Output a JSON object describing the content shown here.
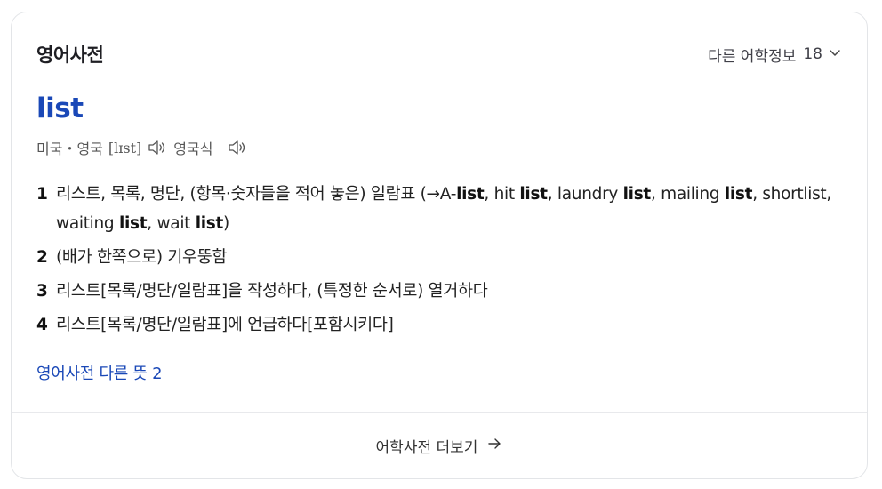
{
  "header": {
    "title": "영어사전",
    "more_label": "다른 어학정보",
    "more_count": "18"
  },
  "entry": {
    "word": "list",
    "pron_region_1": "미국・영국",
    "ipa": "[lɪst]",
    "pron_region_2": "영국식"
  },
  "definitions": [
    {
      "num": "1",
      "parts": [
        {
          "t": "리스트, 목록, 명단, (항목·숫자들을 적어 놓은) 일람표 (→A-",
          "b": false
        },
        {
          "t": "list",
          "b": true
        },
        {
          "t": ", hit ",
          "b": false
        },
        {
          "t": "list",
          "b": true
        },
        {
          "t": ", laundry ",
          "b": false
        },
        {
          "t": "list",
          "b": true
        },
        {
          "t": ", mailing ",
          "b": false
        },
        {
          "t": "list",
          "b": true
        },
        {
          "t": ", shortlist, waiting ",
          "b": false
        },
        {
          "t": "list",
          "b": true
        },
        {
          "t": ", wait ",
          "b": false
        },
        {
          "t": "list",
          "b": true
        },
        {
          "t": ")",
          "b": false
        }
      ]
    },
    {
      "num": "2",
      "parts": [
        {
          "t": "(배가 한쪽으로) 기우뚱함",
          "b": false
        }
      ]
    },
    {
      "num": "3",
      "parts": [
        {
          "t": "리스트[목록/명단/일람표]을 작성하다, (특정한 순서로) 열거하다",
          "b": false
        }
      ]
    },
    {
      "num": "4",
      "parts": [
        {
          "t": "리스트[목록/명단/일람표]에 언급하다[포함시키다]",
          "b": false
        }
      ]
    }
  ],
  "other_meanings_link": "영어사전 다른 뜻 2",
  "footer": {
    "label": "어학사전 더보기"
  },
  "colors": {
    "accent": "#1a48b7",
    "border": "#e3e5e8"
  },
  "icons": {
    "more_dropdown": "chevron-down-icon",
    "pron_1": "speaker-icon",
    "pron_2": "speaker-icon",
    "footer_arrow": "arrow-right-icon"
  }
}
